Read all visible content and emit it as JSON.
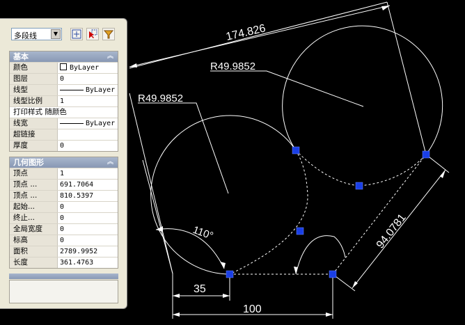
{
  "toolbar": {
    "object_type": "多段线"
  },
  "sections": {
    "basic": {
      "title": "基本",
      "rows": [
        {
          "label": "颜色",
          "value": "ByLayer"
        },
        {
          "label": "图层",
          "value": "0"
        },
        {
          "label": "线型",
          "value": "ByLayer"
        },
        {
          "label": "线型比例",
          "value": "1"
        },
        {
          "label": "打印样式",
          "value": "随颜色"
        },
        {
          "label": "线宽",
          "value": "ByLayer"
        },
        {
          "label": "超链接",
          "value": ""
        },
        {
          "label": "厚度",
          "value": "0"
        }
      ]
    },
    "geometry": {
      "title": "几何图形",
      "rows": [
        {
          "label": "顶点",
          "value": "1"
        },
        {
          "label": "顶点 ...",
          "value": "691.7064"
        },
        {
          "label": "顶点 ...",
          "value": "810.5397"
        },
        {
          "label": "起始...",
          "value": "0"
        },
        {
          "label": "终止...",
          "value": "0"
        },
        {
          "label": "全局宽度",
          "value": "0"
        },
        {
          "label": "标高",
          "value": "0"
        },
        {
          "label": "面积",
          "value": "2789.9952"
        },
        {
          "label": "长度",
          "value": "361.4763"
        }
      ]
    }
  },
  "drawing": {
    "dimensions": {
      "top_aligned": "174.826",
      "radius_upper": "R49.9852",
      "radius_lower": "R49.9852",
      "angle": "110°",
      "diag_aligned": "94.0781",
      "short_linear": "35",
      "long_linear": "100"
    },
    "colors": {
      "background": "#000000",
      "geometry": "#ffffff",
      "grip": "#1a3fe6"
    }
  }
}
